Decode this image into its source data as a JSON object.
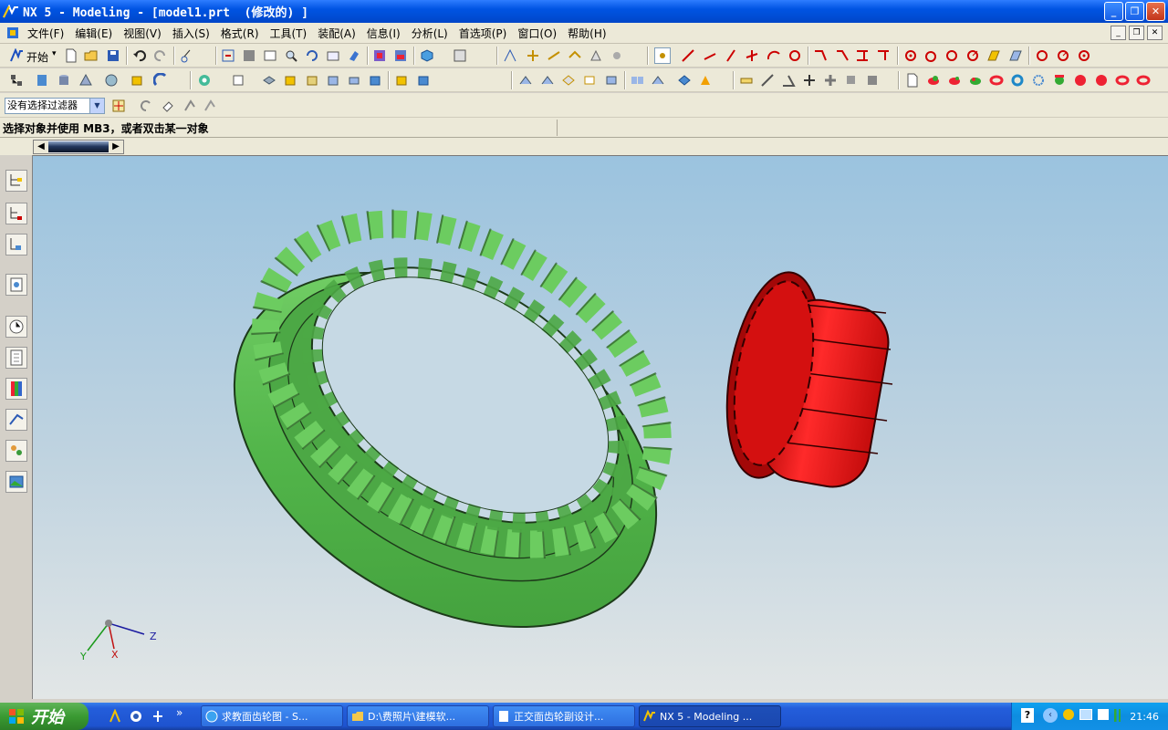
{
  "window": {
    "title": "NX 5 - Modeling - [model1.prt  (修改的) ]"
  },
  "menu": [
    "文件(F)",
    "编辑(E)",
    "视图(V)",
    "插入(S)",
    "格式(R)",
    "工具(T)",
    "装配(A)",
    "信息(I)",
    "分析(L)",
    "首选项(P)",
    "窗口(O)",
    "帮助(H)"
  ],
  "toolbar": {
    "start_label": "开始",
    "start_dropdown": "▾"
  },
  "filter": {
    "value": "没有选择过滤器"
  },
  "cue": {
    "text": "选择对象并使用 MB3，或者双击某一对象"
  },
  "colors": {
    "ring_gear": "#5cbf55",
    "pinion": "#e61414",
    "title_blue": "#0054e3"
  },
  "triad": {
    "z": "Z",
    "y": "Y",
    "x": "X"
  },
  "taskbar": {
    "start": "开始",
    "tasks": [
      "求教面齿轮图 - S...",
      "D:\\费照片\\建模软...",
      "正交面齿轮副设计...",
      "NX 5 - Modeling ..."
    ],
    "clock": "21:46"
  }
}
